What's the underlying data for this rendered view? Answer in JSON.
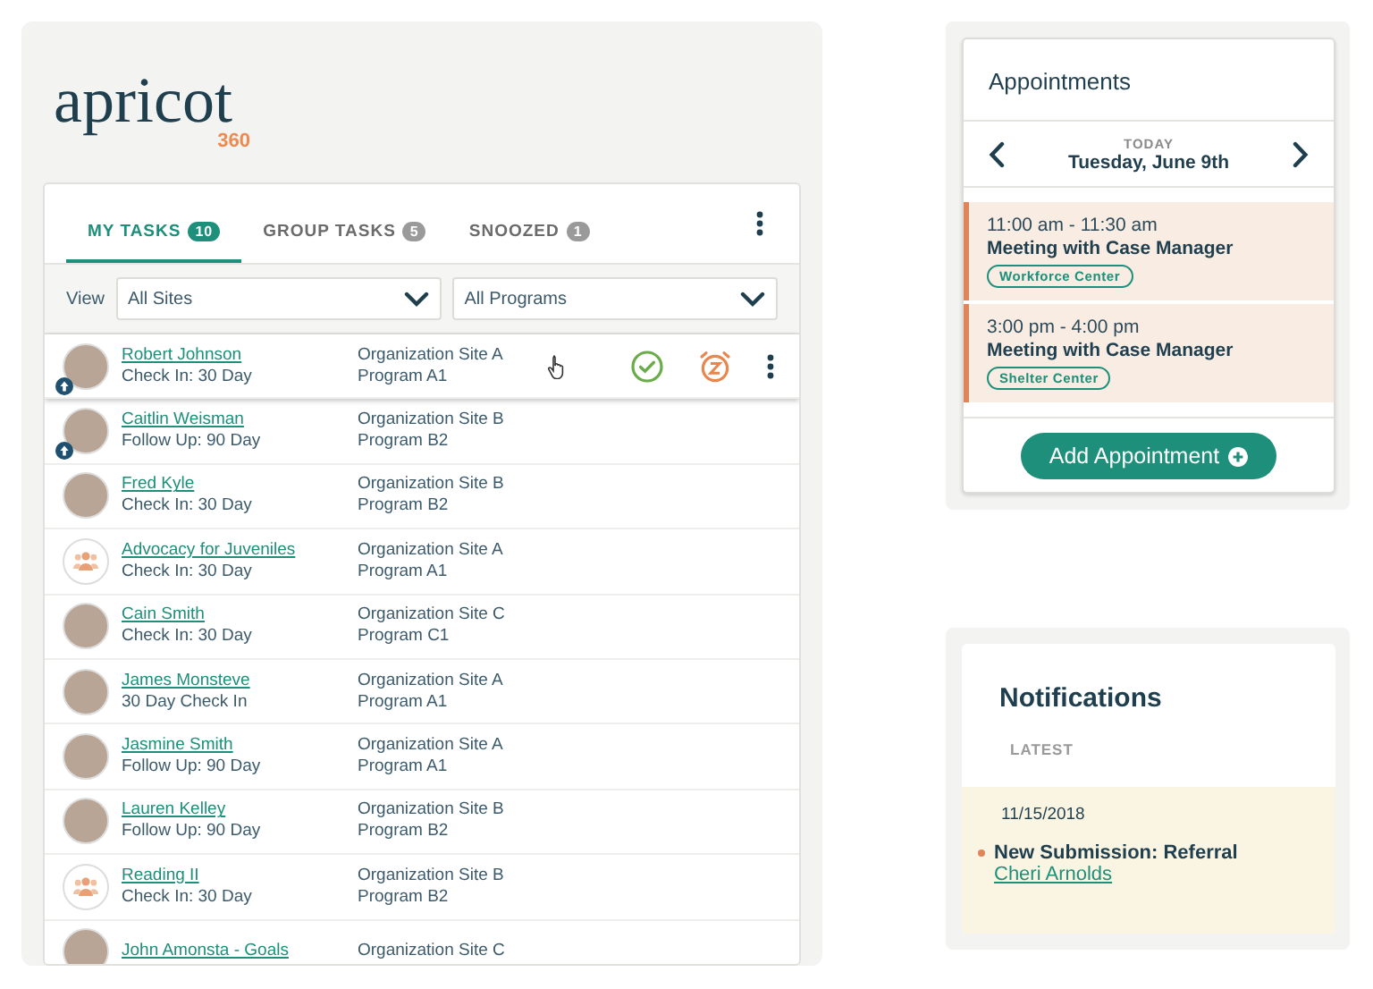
{
  "logo": {
    "word": "apricot",
    "suffix": "360"
  },
  "tasks": {
    "tabs": [
      {
        "label": "MY TASKS",
        "count": "10",
        "selected": true
      },
      {
        "label": "GROUP TASKS",
        "count": "5",
        "selected": false
      },
      {
        "label": "SNOOZED",
        "count": "1",
        "selected": false
      }
    ],
    "filter_label": "View",
    "filters": [
      {
        "value": "All Sites"
      },
      {
        "value": "All Programs"
      }
    ],
    "rows": [
      {
        "kind": "photo",
        "priority": true,
        "active": true,
        "name": "Robert Johnson",
        "task": "Check In: 30 Day",
        "site": "Organization Site A",
        "program": "Program A1"
      },
      {
        "kind": "photo",
        "priority": true,
        "active": false,
        "name": "Caitlin Weisman",
        "task": "Follow Up: 90 Day",
        "site": "Organization Site B",
        "program": "Program B2"
      },
      {
        "kind": "photo",
        "priority": false,
        "active": false,
        "name": "Fred Kyle",
        "task": "Check In: 30 Day",
        "site": "Organization Site B",
        "program": "Program B2"
      },
      {
        "kind": "group",
        "priority": false,
        "active": false,
        "name": "Advocacy for Juveniles",
        "task": "Check In: 30 Day",
        "site": "Organization Site A",
        "program": "Program A1"
      },
      {
        "kind": "photo",
        "priority": false,
        "active": false,
        "name": "Cain Smith",
        "task": "Check In: 30 Day",
        "site": "Organization Site C",
        "program": "Program C1"
      },
      {
        "kind": "photo",
        "priority": false,
        "active": false,
        "name": "James Monsteve",
        "task": "30 Day Check In",
        "site": "Organization Site A",
        "program": "Program A1"
      },
      {
        "kind": "photo",
        "priority": false,
        "active": false,
        "name": "Jasmine Smith",
        "task": "Follow Up: 90 Day",
        "site": "Organization Site A",
        "program": "Program A1"
      },
      {
        "kind": "photo",
        "priority": false,
        "active": false,
        "name": "Lauren Kelley",
        "task": "Follow Up: 90 Day",
        "site": "Organization Site B",
        "program": "Program B2"
      },
      {
        "kind": "group",
        "priority": false,
        "active": false,
        "name": "Reading II",
        "task": "Check In: 30 Day",
        "site": "Organization Site B",
        "program": "Program B2"
      },
      {
        "kind": "photo",
        "priority": false,
        "active": false,
        "name": "John Amonsta - Goals",
        "site": "Organization Site C"
      }
    ]
  },
  "appointments": {
    "title": "Appointments",
    "day_label": "TODAY",
    "date": "Tuesday, June 9th",
    "items": [
      {
        "time": "11:00 am - 11:30 am",
        "title": "Meeting with Case Manager",
        "tag": "Workforce Center"
      },
      {
        "time": "3:00 pm - 4:00 pm",
        "title": "Meeting with Case Manager",
        "tag": "Shelter Center"
      }
    ],
    "add_button": "Add Appointment"
  },
  "notifications": {
    "title": "Notifications",
    "section": "LATEST",
    "items": [
      {
        "date": "11/15/2018",
        "unread": true,
        "title": "New Submission: Referral",
        "link": "Cheri Arnolds"
      }
    ]
  }
}
